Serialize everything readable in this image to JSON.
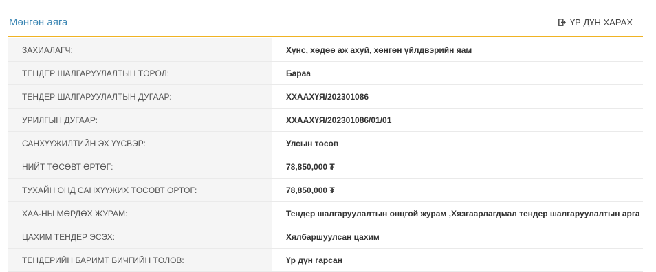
{
  "header": {
    "title": "Мөнгөн аяга",
    "result_link": "ҮР ДҮН ХАРАХ"
  },
  "rows": [
    {
      "label": "ЗАХИАЛАГЧ:",
      "value": "Хүнс, хөдөө аж ахуй, хөнгөн үйлдвэрийн яам"
    },
    {
      "label": "ТЕНДЕР ШАЛГАРУУЛАЛТЫН ТӨРӨЛ:",
      "value": "Бараа"
    },
    {
      "label": "ТЕНДЕР ШАЛГАРУУЛАЛТЫН ДУГААР:",
      "value": "ХХААХҮЯ/202301086"
    },
    {
      "label": "УРИЛГЫН ДУГААР:",
      "value": "ХХААХҮЯ/202301086/01/01"
    },
    {
      "label": "САНХҮҮЖИЛТИЙН ЭХ ҮҮСВЭР:",
      "value": "Улсын төсөв"
    },
    {
      "label": "НИЙТ ТӨСӨВТ ӨРТӨГ:",
      "value": "78,850,000 ₮"
    },
    {
      "label": "ТУХАЙН ОНД САНХҮҮЖИХ ТӨСӨВТ ӨРТӨГ:",
      "value": "78,850,000 ₮"
    },
    {
      "label": "ХАА-НЫ МӨРДӨХ ЖУРАМ:",
      "value": "Тендер шалгаруулалтын онцгой журам ,Хязгаарлагдмал тендер шалгаруулалтын арга"
    },
    {
      "label": "ЦАХИМ ТЕНДЕР ЭСЭХ:",
      "value": "Хялбаршуулсан цахим"
    },
    {
      "label": "ТЕНДЕРИЙН БАРИМТ БИЧГИЙН ТӨЛӨВ:",
      "value": "Үр дүн гарсан"
    }
  ]
}
